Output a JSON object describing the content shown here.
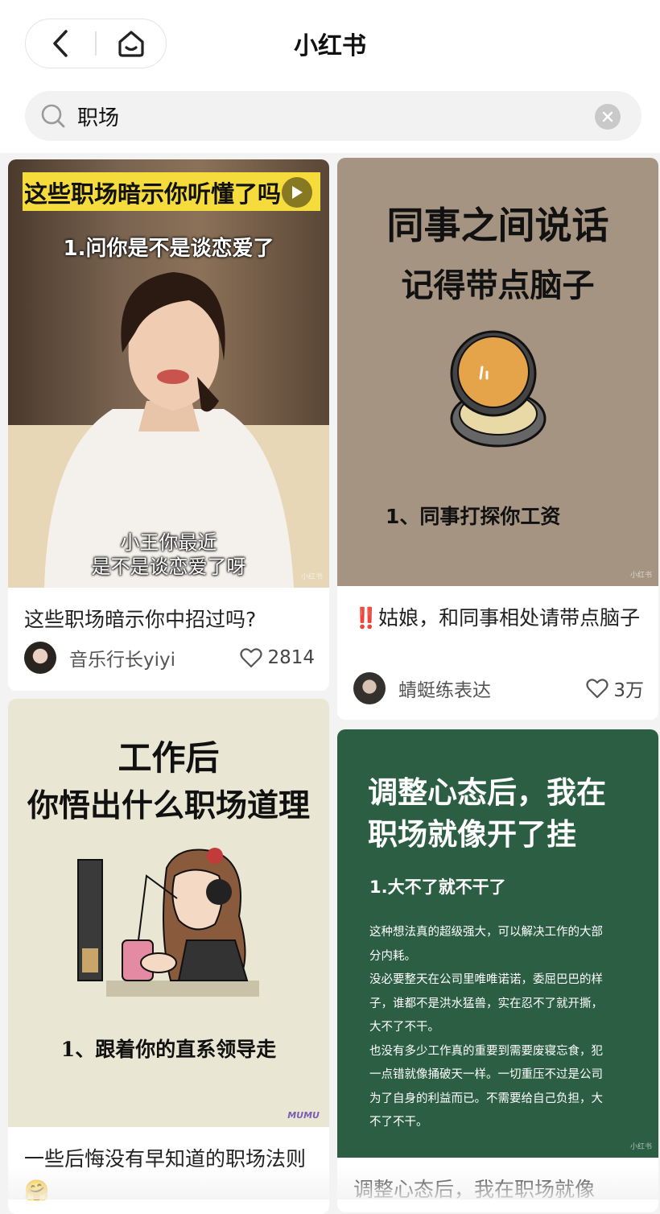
{
  "app": {
    "title": "小红书"
  },
  "search": {
    "query": "职场"
  },
  "cards": [
    {
      "cover_caption": "这些职场暗示你听懂了吗",
      "cover_line1": "1.问你是不是谈恋爱了",
      "subtitle_line1": "小王你最近",
      "subtitle_line2": "是不是谈恋爱了呀",
      "title": "这些职场暗示你中招过吗?",
      "author": "音乐行长yiyi",
      "likes": "2814",
      "watermark": "小红书"
    },
    {
      "cover_line1": "同事之间说话",
      "cover_line2": "记得带点脑子",
      "cover_point": "1、同事打探你工资",
      "title": "‼️姑娘，和同事相处请带点脑子",
      "author": "蜻蜓练表达",
      "likes": "3万",
      "watermark": "小红书"
    },
    {
      "cover_line1": "工作后",
      "cover_line2": "你悟出什么职场道理",
      "cover_point": "1、跟着你的直系领导走",
      "cover_signature": "MUMU",
      "title": "一些后悔没有早知道的职场法则🤗"
    },
    {
      "cover_line1": "调整心态后，我在",
      "cover_line2": "职场就像开了挂",
      "cover_point": "1.大不了就不干了",
      "cover_body": [
        "这种想法真的超级强大，可以解决工作的大部",
        "分内耗。",
        "没必要整天在公司里唯唯诺诺，委屈巴巴的样",
        "子，谁都不是洪水猛兽，实在忍不了就开撕，",
        "大不了不干。",
        "也没有多少工作真的重要到需要废寝忘食，犯",
        "一点错就像捅破天一样。一切重压不过是公司",
        "为了自身的利益而已。不需要给自己负担，大",
        "不了不干。"
      ],
      "title": "调整心态后，我在职场就像",
      "watermark": "小红书"
    }
  ],
  "colors": {
    "caption_yellow": "#f5dc3c",
    "beige_cover": "#a69483",
    "cream_cover": "#e9e6d3",
    "green_cover": "#2b5e42"
  }
}
